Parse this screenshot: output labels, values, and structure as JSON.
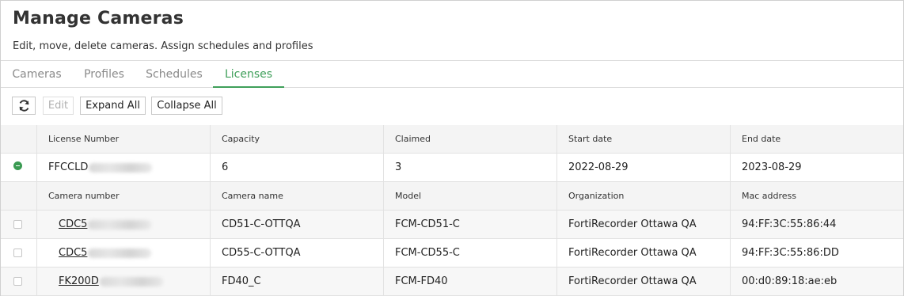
{
  "header": {
    "title": "Manage Cameras",
    "subtitle": "Edit, move, delete cameras. Assign schedules and profiles"
  },
  "tabs": [
    {
      "label": "Cameras",
      "active": false
    },
    {
      "label": "Profiles",
      "active": false
    },
    {
      "label": "Schedules",
      "active": false
    },
    {
      "label": "Licenses",
      "active": true
    }
  ],
  "toolbar": {
    "refresh_icon": "refresh-icon",
    "edit_label": "Edit",
    "expand_label": "Expand All",
    "collapse_label": "Collapse All"
  },
  "license_table": {
    "columns": [
      "License Number",
      "Capacity",
      "Claimed",
      "Start date",
      "End date"
    ],
    "rows": [
      {
        "license_number": "FFCCLD",
        "capacity": "6",
        "claimed": "3",
        "start_date": "2022-08-29",
        "end_date": "2023-08-29"
      }
    ]
  },
  "camera_table": {
    "columns": [
      "Camera number",
      "Camera name",
      "Model",
      "Organization",
      "Mac address"
    ],
    "rows": [
      {
        "camera_number": "CDC5",
        "camera_name": "CD51-C-OTTQA",
        "model": "FCM-CD51-C",
        "organization": "FortiRecorder Ottawa QA",
        "mac_address": "94:FF:3C:55:86:44"
      },
      {
        "camera_number": "CDC5",
        "camera_name": "CD55-C-OTTQA",
        "model": "FCM-CD55-C",
        "organization": "FortiRecorder Ottawa QA",
        "mac_address": "94:FF:3C:55:86:DD"
      },
      {
        "camera_number": "FK200D",
        "camera_name": "FD40_C",
        "model": "FCM-FD40",
        "organization": "FortiRecorder Ottawa QA",
        "mac_address": "00:d0:89:18:ae:eb"
      }
    ]
  },
  "colors": {
    "accent": "#3f9f5a",
    "tab_inactive": "#8a8a8a",
    "header_bg": "#f4f4f4"
  }
}
